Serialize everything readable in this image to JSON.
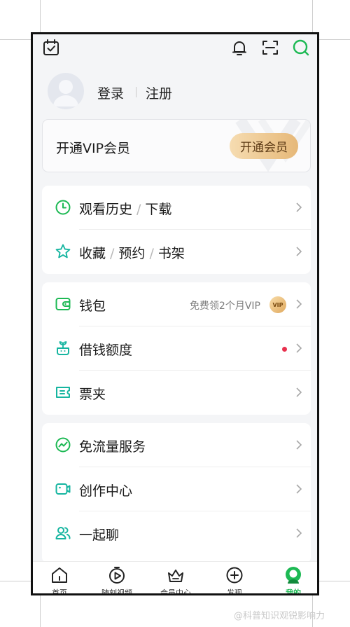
{
  "colors": {
    "accent": "#1db954",
    "icon_teal": "#16b5a0",
    "vip_gold": "#e6b878",
    "notice_red": "#e8304d"
  },
  "topbar": {
    "icons": [
      "calendar-check-icon",
      "bell-icon",
      "scan-icon",
      "search-icon"
    ]
  },
  "profile": {
    "login_label": "登录",
    "register_label": "注册"
  },
  "vip": {
    "title": "开通VIP会员",
    "button_label": "开通会员"
  },
  "group1": {
    "items": [
      {
        "icon": "clock-icon",
        "parts": [
          "观看历史",
          "/",
          "下载"
        ]
      },
      {
        "icon": "star-icon",
        "parts": [
          "收藏",
          "/",
          "预约",
          "/",
          "书架"
        ]
      }
    ]
  },
  "group2": {
    "items": [
      {
        "icon": "wallet-icon",
        "label": "钱包",
        "hint": "免费领2个月VIP",
        "badge": "VIP"
      },
      {
        "icon": "sprout-icon",
        "label": "借钱额度"
      },
      {
        "icon": "ticket-icon",
        "label": "票夹"
      }
    ]
  },
  "group3": {
    "items": [
      {
        "icon": "data-free-icon",
        "label": "免流量服务"
      },
      {
        "icon": "creator-icon",
        "label": "创作中心"
      },
      {
        "icon": "chat-together-icon",
        "label": "一起聊"
      }
    ]
  },
  "bottomnav": {
    "items": [
      {
        "label": "首页",
        "icon": "home-icon"
      },
      {
        "label": "随刻视频",
        "icon": "play-timer-icon"
      },
      {
        "label": "会员中心",
        "icon": "crown-basket-icon"
      },
      {
        "label": "发现",
        "icon": "plus-circle-icon"
      },
      {
        "label": "我的",
        "icon": "user-avatar-icon",
        "active": true
      }
    ]
  },
  "watermark": "@科普知识观锐影响力"
}
